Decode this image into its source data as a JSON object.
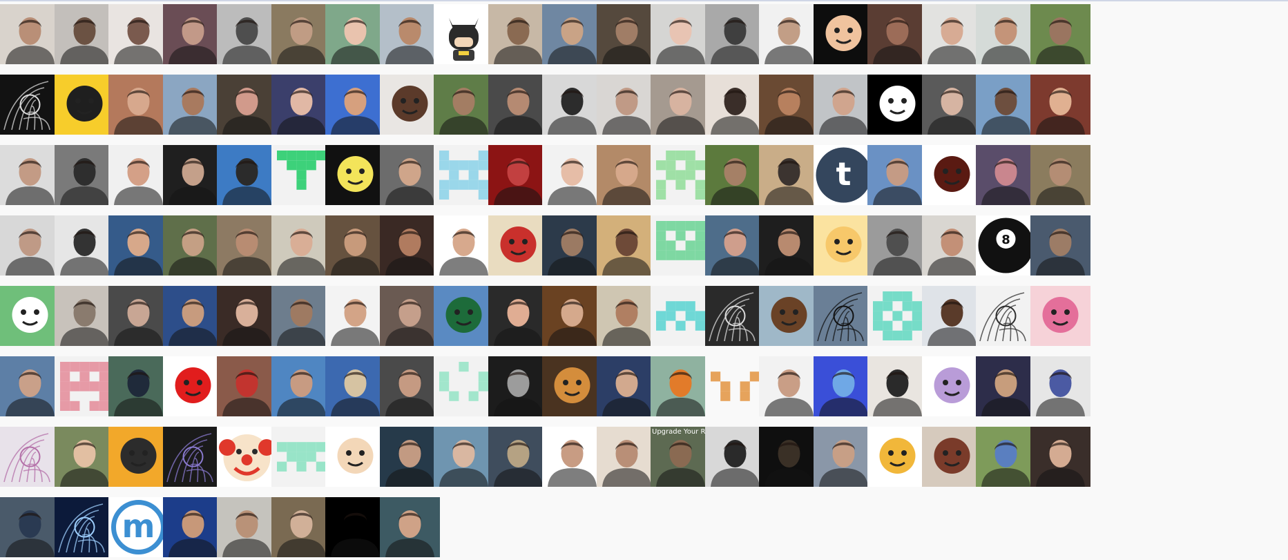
{
  "page": {
    "background": "#f9f9f9"
  },
  "avatars": [
    {
      "kind": "photo",
      "bg": "#d9d3cc",
      "fg": "#b98f77"
    },
    {
      "kind": "photo",
      "bg": "#c3bfbb",
      "fg": "#6b5243"
    },
    {
      "kind": "photo",
      "bg": "#e9e4e1",
      "fg": "#7a5a4e"
    },
    {
      "kind": "photo",
      "bg": "#6a4d55",
      "fg": "#c29988"
    },
    {
      "kind": "photo",
      "bg": "#bcbcbc",
      "fg": "#4e4e4e"
    },
    {
      "kind": "photo",
      "bg": "#8a7a60",
      "fg": "#c09c84"
    },
    {
      "kind": "photo",
      "bg": "#7fa88a",
      "fg": "#e9c3ae"
    },
    {
      "kind": "photo",
      "bg": "#b4bfc9",
      "fg": "#b98a6c"
    },
    {
      "kind": "cartoon",
      "icon": "batman-icon",
      "bg": "#ffffff",
      "fg": "#2a2a2a"
    },
    {
      "kind": "photo",
      "bg": "#c7b8a6",
      "fg": "#8a6a52"
    },
    {
      "kind": "photo",
      "bg": "#6f87a2",
      "fg": "#c9a386"
    },
    {
      "kind": "photo",
      "bg": "#55493d",
      "fg": "#a07d66"
    },
    {
      "kind": "photo",
      "bg": "#d5d5d3",
      "fg": "#e8c4b3"
    },
    {
      "kind": "photo",
      "bg": "#a9a9a9",
      "fg": "#3f3f3f"
    },
    {
      "kind": "photo",
      "bg": "#f1f1f1",
      "fg": "#c29e86"
    },
    {
      "kind": "cartoon",
      "icon": "cartoon-face-icon",
      "bg": "#0d0d0d",
      "fg": "#f0c39e"
    },
    {
      "kind": "photo",
      "bg": "#5a3d33",
      "fg": "#9c6c58"
    },
    {
      "kind": "photo",
      "bg": "#e2e2e0",
      "fg": "#d7ab94"
    },
    {
      "kind": "photo",
      "bg": "#d5dbd8",
      "fg": "#c49479"
    },
    {
      "kind": "photo",
      "bg": "#6d8a4e",
      "fg": "#9a7560"
    },
    {
      "kind": "art",
      "icon": "sketch-art-icon",
      "bg": "#121212",
      "fg": "#dcdcdc"
    },
    {
      "kind": "cartoon",
      "icon": "simpsons-face-icon",
      "bg": "#f7cd2b",
      "fg": "#1f1f1f"
    },
    {
      "kind": "photo",
      "bg": "#b4795c",
      "fg": "#d7a88d"
    },
    {
      "kind": "photo",
      "bg": "#8ba6c2",
      "fg": "#a87a5f"
    },
    {
      "kind": "photo",
      "bg": "#4a4036",
      "fg": "#d19a8b"
    },
    {
      "kind": "photo",
      "bg": "#3b3f6b",
      "fg": "#e1b8a5"
    },
    {
      "kind": "photo",
      "bg": "#3d6fd1",
      "fg": "#d6a07e"
    },
    {
      "kind": "cartoon",
      "icon": "lego-figure-icon",
      "bg": "#e9e6e3",
      "fg": "#5b3a2a"
    },
    {
      "kind": "photo",
      "bg": "#5f7d48",
      "fg": "#a37d63"
    },
    {
      "kind": "photo",
      "bg": "#4a4a4a",
      "fg": "#b58a72"
    },
    {
      "kind": "photo",
      "bg": "#d8d8d8",
      "fg": "#2c2c2c"
    },
    {
      "kind": "photo",
      "bg": "#d9d6d3",
      "fg": "#c09a86"
    },
    {
      "kind": "photo",
      "bg": "#a59a90",
      "fg": "#d7b3a0"
    },
    {
      "kind": "photo",
      "bg": "#e7dfd8",
      "fg": "#3a2e29"
    },
    {
      "kind": "photo",
      "bg": "#6a4a33",
      "fg": "#b7805e"
    },
    {
      "kind": "photo",
      "bg": "#c1c4c7",
      "fg": "#d0a58e"
    },
    {
      "kind": "cartoon",
      "icon": "white-silhouette-icon",
      "bg": "#000000",
      "fg": "#ffffff"
    },
    {
      "kind": "photo",
      "bg": "#5a5a5a",
      "fg": "#d6b4a2"
    },
    {
      "kind": "photo",
      "bg": "#7a9fc6",
      "fg": "#6d4f3f"
    },
    {
      "kind": "photo",
      "bg": "#7d3a2e",
      "fg": "#e0b091"
    },
    {
      "kind": "photo",
      "bg": "#dcdcdc",
      "fg": "#c39b85"
    },
    {
      "kind": "photo",
      "bg": "#7a7a7a",
      "fg": "#2e2e2e"
    },
    {
      "kind": "photo",
      "bg": "#f0f0f0",
      "fg": "#d4a087"
    },
    {
      "kind": "photo",
      "bg": "#1f1f1f",
      "fg": "#c4a08a"
    },
    {
      "kind": "photo",
      "bg": "#3d7bc4",
      "fg": "#2b2b2b"
    },
    {
      "kind": "identicon",
      "icon": "identicon",
      "bg": "#f2f2f2",
      "fg": "#3dd17a",
      "pattern": [
        [
          1,
          1,
          1,
          1,
          1
        ],
        [
          0,
          1,
          1,
          1,
          0
        ],
        [
          0,
          0,
          1,
          0,
          0
        ],
        [
          0,
          0,
          1,
          0,
          0
        ],
        [
          0,
          0,
          0,
          0,
          0
        ]
      ]
    },
    {
      "kind": "cartoon",
      "icon": "lightning-character-icon",
      "bg": "#111111",
      "fg": "#f3e45a"
    },
    {
      "kind": "photo",
      "bg": "#6c6c6c",
      "fg": "#cfa58a"
    },
    {
      "kind": "identicon",
      "icon": "identicon",
      "bg": "#f2f2f2",
      "fg": "#9ad7ea",
      "pattern": [
        [
          1,
          0,
          0,
          0,
          1
        ],
        [
          1,
          1,
          1,
          1,
          1
        ],
        [
          0,
          1,
          0,
          1,
          0
        ],
        [
          1,
          1,
          1,
          1,
          1
        ],
        [
          1,
          0,
          0,
          0,
          1
        ]
      ]
    },
    {
      "kind": "photo",
      "bg": "#8c1414",
      "fg": "#c24040"
    },
    {
      "kind": "photo",
      "bg": "#f2f2f2",
      "fg": "#e6bda7"
    },
    {
      "kind": "photo",
      "bg": "#b38a68",
      "fg": "#d6a88b"
    },
    {
      "kind": "identicon",
      "icon": "identicon",
      "bg": "#f2f2f2",
      "fg": "#9fe0a6",
      "pattern": [
        [
          0,
          1,
          1,
          1,
          0
        ],
        [
          1,
          1,
          0,
          1,
          1
        ],
        [
          0,
          1,
          1,
          1,
          0
        ],
        [
          1,
          0,
          1,
          0,
          1
        ],
        [
          1,
          0,
          0,
          0,
          1
        ]
      ]
    },
    {
      "kind": "photo",
      "bg": "#5c7a3d",
      "fg": "#a58066"
    },
    {
      "kind": "photo",
      "bg": "#c9ad88",
      "fg": "#3c3430"
    },
    {
      "kind": "logo",
      "icon": "tumblr-logo-icon",
      "bg": "#ffffff",
      "fg": "#34465d",
      "glyph": "t"
    },
    {
      "kind": "photo",
      "bg": "#6a91c4",
      "fg": "#c49b85"
    },
    {
      "kind": "cartoon",
      "icon": "spiky-hair-icon",
      "bg": "#ffffff",
      "fg": "#5a1a12"
    },
    {
      "kind": "photo",
      "bg": "#5a4d6a",
      "fg": "#c9868e"
    },
    {
      "kind": "photo",
      "bg": "#8b7c5e",
      "fg": "#b48d74"
    },
    {
      "kind": "photo",
      "bg": "#d8d8d8",
      "fg": "#bf9a86"
    },
    {
      "kind": "photo",
      "bg": "#e6e6e6",
      "fg": "#333333"
    },
    {
      "kind": "photo",
      "bg": "#355b8a",
      "fg": "#d7a88a"
    },
    {
      "kind": "photo",
      "bg": "#5f6f4a",
      "fg": "#c49f84"
    },
    {
      "kind": "photo",
      "bg": "#8d7a63",
      "fg": "#b88c72"
    },
    {
      "kind": "photo",
      "bg": "#cfcabc",
      "fg": "#d9ae96"
    },
    {
      "kind": "photo",
      "bg": "#66523f",
      "fg": "#c79a7b"
    },
    {
      "kind": "photo",
      "bg": "#3a2924",
      "fg": "#b07b5f"
    },
    {
      "kind": "photo",
      "bg": "#ffffff",
      "fg": "#d7a98d"
    },
    {
      "kind": "cartoon",
      "icon": "waldo-icon",
      "bg": "#e9dcc0",
      "fg": "#c9302c"
    },
    {
      "kind": "photo",
      "bg": "#2c3a4a",
      "fg": "#9b7a63"
    },
    {
      "kind": "photo",
      "bg": "#d3b07a",
      "fg": "#6e4a38"
    },
    {
      "kind": "identicon",
      "icon": "identicon",
      "bg": "#f2f2f2",
      "fg": "#7ed8a2",
      "pattern": [
        [
          1,
          1,
          1,
          1,
          1
        ],
        [
          1,
          0,
          1,
          0,
          1
        ],
        [
          1,
          1,
          0,
          1,
          1
        ],
        [
          1,
          1,
          1,
          1,
          1
        ],
        [
          0,
          0,
          0,
          0,
          0
        ]
      ]
    },
    {
      "kind": "photo",
      "bg": "#4e6d8a",
      "fg": "#cf9e8c"
    },
    {
      "kind": "photo",
      "bg": "#1e1e1e",
      "fg": "#b88a6f"
    },
    {
      "kind": "cartoon",
      "icon": "luffy-icon",
      "bg": "#fbe3a0",
      "fg": "#f7c86a"
    },
    {
      "kind": "photo",
      "bg": "#9b9b9b",
      "fg": "#4f4f4f"
    },
    {
      "kind": "photo",
      "bg": "#d9d6d1",
      "fg": "#c39077"
    },
    {
      "kind": "logo",
      "icon": "eight-ball-icon",
      "bg": "#ffffff",
      "fg": "#111111",
      "glyph": "8"
    },
    {
      "kind": "photo",
      "bg": "#4a5a6e",
      "fg": "#9c7c66"
    },
    {
      "kind": "cartoon",
      "icon": "gopher-icon",
      "bg": "#6fbf7a",
      "fg": "#ffffff"
    },
    {
      "kind": "photo",
      "bg": "#c8c2bb",
      "fg": "#8a7b6e"
    },
    {
      "kind": "photo",
      "bg": "#4a4a4a",
      "fg": "#c8a694"
    },
    {
      "kind": "photo",
      "bg": "#2d4e8a",
      "fg": "#c79b7e"
    },
    {
      "kind": "photo",
      "bg": "#3a2b26",
      "fg": "#d9b09a"
    },
    {
      "kind": "photo",
      "bg": "#6d7d8d",
      "fg": "#9e7a62"
    },
    {
      "kind": "photo",
      "bg": "#f3f3f3",
      "fg": "#d3a487"
    },
    {
      "kind": "photo",
      "bg": "#6a5a52",
      "fg": "#c59f8b"
    },
    {
      "kind": "cartoon",
      "icon": "green-figurine-icon",
      "bg": "#5a8ac2",
      "fg": "#1d6b3a"
    },
    {
      "kind": "photo",
      "bg": "#2a2a2a",
      "fg": "#e0ad93"
    },
    {
      "kind": "photo",
      "bg": "#6a4222",
      "fg": "#d5a98c"
    },
    {
      "kind": "photo",
      "bg": "#cfc6b2",
      "fg": "#b07f62"
    },
    {
      "kind": "identicon",
      "icon": "identicon",
      "bg": "#f2f2f2",
      "fg": "#6fd8d6",
      "pattern": [
        [
          0,
          0,
          0,
          0,
          0
        ],
        [
          0,
          1,
          1,
          1,
          0
        ],
        [
          1,
          1,
          0,
          1,
          1
        ],
        [
          1,
          0,
          1,
          0,
          1
        ],
        [
          0,
          0,
          0,
          0,
          0
        ]
      ]
    },
    {
      "kind": "art",
      "icon": "disco-ball-icon",
      "bg": "#2a2a2a",
      "fg": "#dddddd"
    },
    {
      "kind": "cartoon",
      "icon": "bear-icon",
      "bg": "#9fb8c8",
      "fg": "#6a4226"
    },
    {
      "kind": "art",
      "icon": "silhouette-jump-icon",
      "bg": "#6a7f96",
      "fg": "#111111"
    },
    {
      "kind": "identicon",
      "icon": "identicon",
      "bg": "#f2f2f2",
      "fg": "#76dcc8",
      "pattern": [
        [
          0,
          1,
          1,
          1,
          0
        ],
        [
          1,
          1,
          0,
          1,
          1
        ],
        [
          1,
          0,
          1,
          0,
          1
        ],
        [
          1,
          1,
          0,
          1,
          1
        ],
        [
          0,
          1,
          1,
          1,
          0
        ]
      ]
    },
    {
      "kind": "photo",
      "bg": "#dfe3e8",
      "fg": "#5a3b2a"
    },
    {
      "kind": "art",
      "icon": "sketch-portrait-icon",
      "bg": "#f2f2f2",
      "fg": "#2c2c2c"
    },
    {
      "kind": "cartoon",
      "icon": "anime-pink-hair-icon",
      "bg": "#f6d2d8",
      "fg": "#e46f9a"
    },
    {
      "kind": "photo",
      "bg": "#5d7fa6",
      "fg": "#c9a089"
    },
    {
      "kind": "identicon",
      "icon": "identicon",
      "bg": "#f2f2f2",
      "fg": "#e69aa6",
      "pattern": [
        [
          1,
          1,
          1,
          1,
          1
        ],
        [
          1,
          0,
          1,
          0,
          1
        ],
        [
          1,
          1,
          1,
          1,
          1
        ],
        [
          1,
          0,
          0,
          0,
          1
        ],
        [
          1,
          1,
          0,
          1,
          1
        ]
      ]
    },
    {
      "kind": "photo",
      "bg": "#4a6a5a",
      "fg": "#1f2a3a"
    },
    {
      "kind": "cartoon",
      "icon": "ghost-eye-icon",
      "bg": "#ffffff",
      "fg": "#e11d1d"
    },
    {
      "kind": "photo",
      "bg": "#8a5a4a",
      "fg": "#c2342f"
    },
    {
      "kind": "photo",
      "bg": "#4f86c2",
      "fg": "#c79b82"
    },
    {
      "kind": "photo",
      "bg": "#3c69b0",
      "fg": "#d6c3a2"
    },
    {
      "kind": "photo",
      "bg": "#4a4a4a",
      "fg": "#c59a82"
    },
    {
      "kind": "identicon",
      "icon": "identicon",
      "bg": "#f2f2f2",
      "fg": "#a2e6cc",
      "pattern": [
        [
          0,
          0,
          1,
          0,
          0
        ],
        [
          1,
          0,
          0,
          0,
          1
        ],
        [
          1,
          0,
          0,
          0,
          1
        ],
        [
          0,
          1,
          0,
          1,
          0
        ],
        [
          0,
          0,
          0,
          0,
          0
        ]
      ]
    },
    {
      "kind": "photo",
      "bg": "#1c1c1c",
      "fg": "#9c9c9c"
    },
    {
      "kind": "cartoon",
      "icon": "cat-icon",
      "bg": "#4a3320",
      "fg": "#d48d3c"
    },
    {
      "kind": "photo",
      "bg": "#2c3e66",
      "fg": "#d2a98e"
    },
    {
      "kind": "photo",
      "bg": "#8fb2a0",
      "fg": "#e27b2a"
    },
    {
      "kind": "identicon",
      "icon": "identicon",
      "bg": "#f9f9f9",
      "fg": "#e6a35c",
      "pattern": [
        [
          0,
          0,
          0,
          0,
          0
        ],
        [
          1,
          0,
          0,
          0,
          1
        ],
        [
          0,
          1,
          0,
          1,
          0
        ],
        [
          0,
          1,
          0,
          1,
          0
        ],
        [
          0,
          0,
          0,
          0,
          0
        ]
      ]
    },
    {
      "kind": "photo",
      "bg": "#f2f2f2",
      "fg": "#c99e86"
    },
    {
      "kind": "photo",
      "bg": "#3a4fd8",
      "fg": "#6fa8e6"
    },
    {
      "kind": "photo",
      "bg": "#e9e5e0",
      "fg": "#2a2a2a"
    },
    {
      "kind": "cartoon",
      "icon": "android-robot-icon",
      "bg": "#ffffff",
      "fg": "#b99cd8"
    },
    {
      "kind": "photo",
      "bg": "#2d2d4a",
      "fg": "#c79d7c"
    },
    {
      "kind": "photo",
      "bg": "#e6e6e6",
      "fg": "#4b5aa3"
    },
    {
      "kind": "art",
      "icon": "sketch-paint-icon",
      "bg": "#e8e2ea",
      "fg": "#b46fa8"
    },
    {
      "kind": "photo",
      "bg": "#7a8a5e",
      "fg": "#e2bfa2"
    },
    {
      "kind": "cartoon",
      "icon": "glasses-cartoon-icon",
      "bg": "#f2a82a",
      "fg": "#2c2c2c"
    },
    {
      "kind": "art",
      "icon": "spiral-art-icon",
      "bg": "#1a1a1a",
      "fg": "#8a7ad0"
    },
    {
      "kind": "cartoon",
      "icon": "clown-icon",
      "bg": "#ffffff",
      "fg": "#e0382b"
    },
    {
      "kind": "identicon",
      "icon": "identicon",
      "bg": "#f2f2f2",
      "fg": "#98e4c8",
      "pattern": [
        [
          0,
          0,
          0,
          0,
          0
        ],
        [
          1,
          1,
          1,
          1,
          1
        ],
        [
          0,
          1,
          1,
          1,
          0
        ],
        [
          1,
          0,
          1,
          0,
          1
        ],
        [
          0,
          0,
          0,
          0,
          0
        ]
      ]
    },
    {
      "kind": "cartoon",
      "icon": "stewie-icon",
      "bg": "#ffffff",
      "fg": "#f3d7b8"
    },
    {
      "kind": "photo",
      "bg": "#263a4a",
      "fg": "#c29a82"
    },
    {
      "kind": "photo",
      "bg": "#6f95b0",
      "fg": "#d9b7a1"
    },
    {
      "kind": "photo",
      "bg": "#3f4d5d",
      "fg": "#b5a283"
    },
    {
      "kind": "photo",
      "bg": "#ffffff",
      "fg": "#c89c83"
    },
    {
      "kind": "photo",
      "bg": "#e6dcd0",
      "fg": "#b98f77"
    },
    {
      "kind": "photo",
      "bg": "#5d6a52",
      "fg": "#8a6a52",
      "caption": "Upgrade Your Ram"
    },
    {
      "kind": "photo",
      "bg": "#d8d8d8",
      "fg": "#2a2a2a"
    },
    {
      "kind": "photo",
      "bg": "#0f0f0f",
      "fg": "#3a3026"
    },
    {
      "kind": "photo",
      "bg": "#8a97a8",
      "fg": "#c79f86"
    },
    {
      "kind": "cartoon",
      "icon": "yellow-dog-icon",
      "bg": "#ffffff",
      "fg": "#f1b73a"
    },
    {
      "kind": "cartoon",
      "icon": "domo-icon",
      "bg": "#d6cabd",
      "fg": "#7a3b2a"
    },
    {
      "kind": "photo",
      "bg": "#7e9b5a",
      "fg": "#5a7fc0"
    },
    {
      "kind": "photo",
      "bg": "#3a2e2a",
      "fg": "#d4ab92"
    },
    {
      "kind": "photo",
      "bg": "#4a5a6a",
      "fg": "#2a3a52"
    },
    {
      "kind": "art",
      "icon": "nebula-icon",
      "bg": "#0c1a3a",
      "fg": "#9fd0ff"
    },
    {
      "kind": "logo",
      "icon": "m-logo-icon",
      "bg": "#ffffff",
      "fg": "#3c8fd2",
      "glyph": "m"
    },
    {
      "kind": "photo",
      "bg": "#1c3d8a",
      "fg": "#c79879"
    },
    {
      "kind": "photo",
      "bg": "#c5c3bd",
      "fg": "#b99278"
    },
    {
      "kind": "photo",
      "bg": "#7a6a52",
      "fg": "#d1b098"
    },
    {
      "kind": "photo",
      "bg": "#000000",
      "fg": "#000000"
    },
    {
      "kind": "photo",
      "bg": "#3d5a63",
      "fg": "#cfa287"
    }
  ]
}
